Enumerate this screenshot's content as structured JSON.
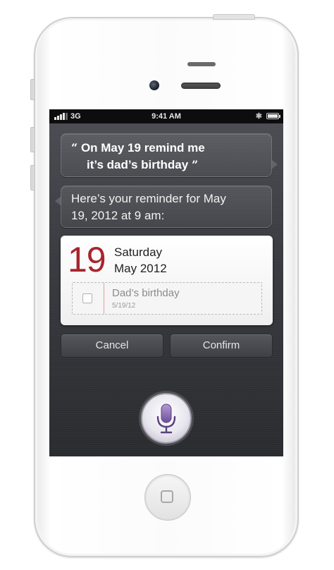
{
  "status_bar": {
    "network": "3G",
    "time": "9:41 AM"
  },
  "conversation": {
    "user_quote_open": "“",
    "user_line1": "On May 19 remind me",
    "user_line2": "it’s dad’s birthday",
    "user_quote_close": "”",
    "siri_response_line1": "Here’s your reminder for May",
    "siri_response_line2": "19, 2012 at 9 am:"
  },
  "reminder_card": {
    "day": "19",
    "weekday": "Saturday",
    "month_year": "May 2012",
    "item_title": "Dad’s birthday",
    "item_date": "5/19/12"
  },
  "actions": {
    "cancel_label": "Cancel",
    "confirm_label": "Confirm"
  },
  "icons": {
    "microphone": "microphone-icon",
    "home": "home-button-icon",
    "bluetooth": "bluetooth-icon",
    "battery": "battery-icon",
    "signal": "signal-bars-icon"
  },
  "colors": {
    "date_accent": "#a8242f",
    "mic_accent": "#7a5aa6"
  }
}
